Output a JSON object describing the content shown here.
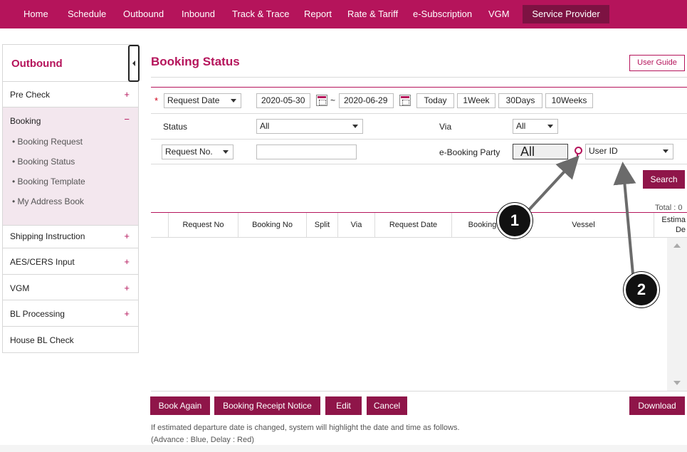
{
  "nav": {
    "items": [
      "Home",
      "Schedule",
      "Outbound",
      "Inbound",
      "Track & Trace",
      "Report",
      "Rate & Tariff",
      "e-Subscription",
      "VGM"
    ],
    "service_provider": "Service Provider"
  },
  "sidebar": {
    "title": "Outbound",
    "pre_check": "Pre Check",
    "booking": "Booking",
    "booking_sub": [
      "• Booking Request",
      "• Booking Status",
      "• Booking Template",
      "• My Address Book"
    ],
    "shipping_instruction": "Shipping Instruction",
    "aes_cers": "AES/CERS Input",
    "vgm": "VGM",
    "bl_processing": "BL Processing",
    "house_bl": "House BL Check",
    "plus": "+",
    "minus": "−"
  },
  "main": {
    "title": "Booking Status",
    "user_guide": "User Guide",
    "required_mark": "*",
    "date_type": "Request Date",
    "date_from": "2020-05-30",
    "date_sep": "~",
    "date_to": "2020-06-29",
    "quick": [
      "Today",
      "1Week",
      "30Days",
      "10Weeks"
    ],
    "status_label": "Status",
    "status_value": "All",
    "via_label": "Via",
    "via_value": "All",
    "ref_type": "Request No.",
    "ref_value": "",
    "party_label": "e-Booking Party",
    "party_value": "All",
    "user_id": "User ID",
    "search": "Search",
    "total": "Total : 0"
  },
  "table": {
    "headers": [
      "Request No",
      "Booking No",
      "Split",
      "Via",
      "Request Date",
      "Booking",
      "Vessel",
      "Estima"
    ],
    "header_tail": "De"
  },
  "actions": {
    "book_again": "Book Again",
    "receipt": "Booking Receipt Notice",
    "edit": "Edit",
    "cancel": "Cancel",
    "download": "Download"
  },
  "notes": {
    "line1": "If estimated departure date is changed, system will highlight the date and time as follows.",
    "line2": "(Advance : Blue, Delay : Red)"
  },
  "callouts": [
    "1",
    "2"
  ],
  "colors": {
    "brand": "#b5145b",
    "button": "#8f1549",
    "nav_active": "#7d1242"
  }
}
